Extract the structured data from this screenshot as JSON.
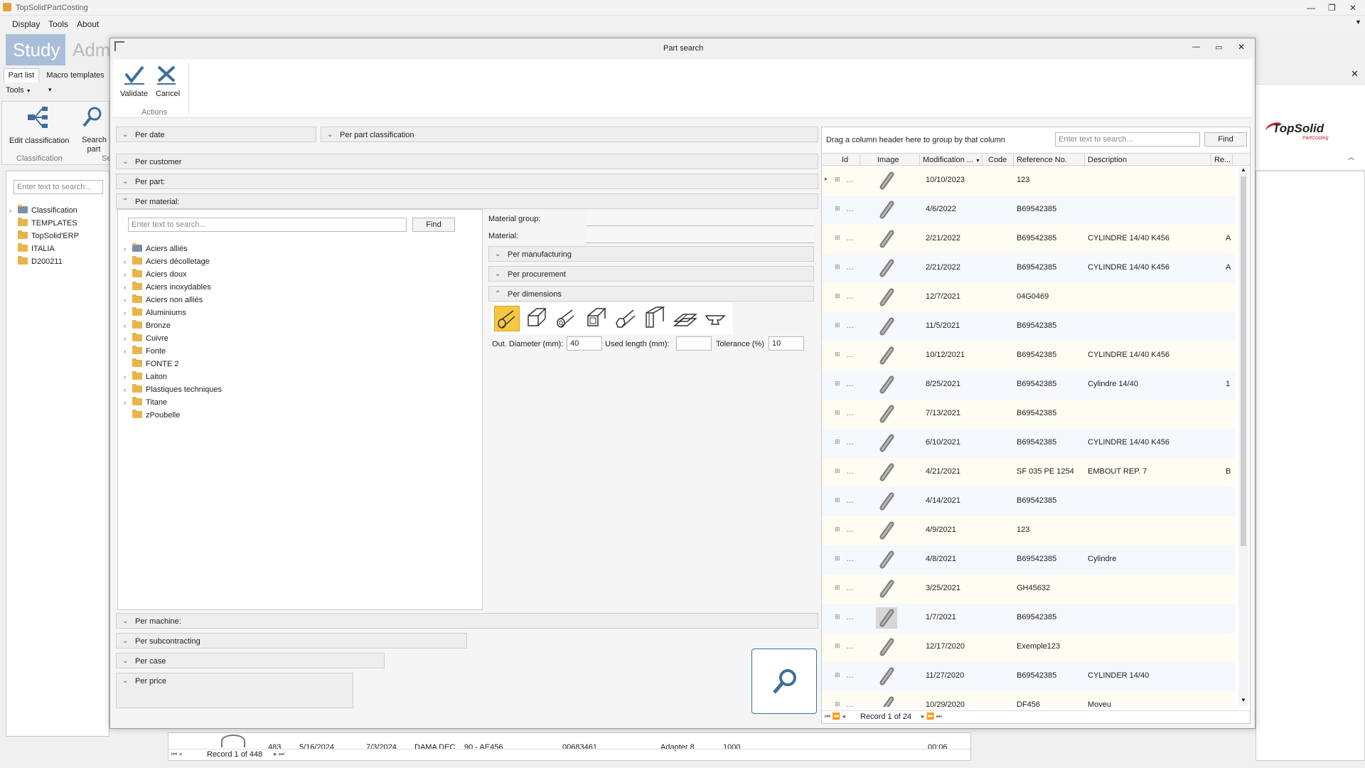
{
  "app": {
    "title": "TopSolid'PartCosting",
    "menu": [
      "Display",
      "Tools",
      "About"
    ]
  },
  "left": {
    "big_tabs": [
      "Study",
      "Adm"
    ],
    "tabs": [
      "Part list",
      "Macro templates"
    ],
    "tools_label": "Tools",
    "ribbon": {
      "edit_label": "Edit classification",
      "search_label": "Search part",
      "group1": "Classification",
      "group2": "Se"
    },
    "search_placeholder": "Enter text to search...",
    "tree": [
      "Classification",
      "TEMPLATES",
      "TopSolid'ERP",
      "ITALIA",
      "D200211"
    ]
  },
  "bottom": {
    "cells": [
      "483",
      "5/16/2024",
      "7/3/2024",
      "DAMA DEC",
      "90 - AE456",
      "00683461",
      "Adapter 8",
      "1000",
      "00:06"
    ],
    "record": "Record 1 of 448"
  },
  "dialog": {
    "title": "Part search",
    "validate": "Validate",
    "cancel": "Cancel",
    "actions": "Actions",
    "sections": {
      "per_date": "Per date",
      "per_part_class": "Per part classification",
      "per_customer": "Per customer",
      "per_part": "Per part:",
      "per_material": "Per material:",
      "per_machine": "Per machine:",
      "per_subcontracting": "Per subcontracting",
      "per_case": "Per case",
      "per_price": "Per price",
      "per_manufacturing": "Per manufacturing",
      "per_procurement": "Per procurement",
      "per_dimensions": "Per dimensions"
    },
    "material_search_placeholder": "Enter text to search...",
    "find": "Find",
    "materials": [
      "Aciers alliés",
      "Aciers décolletage",
      "Aciers doux",
      "Aciers inoxydables",
      "Aciers non alliés",
      "Aluminiums",
      "Bronze",
      "Cuivre",
      "Fonte",
      "FONTE 2",
      "Laiton",
      "Plastiques techniques",
      "Titane",
      "zPoubelle"
    ],
    "material_group_label": "Material group:",
    "material_label": "Material:",
    "dims": {
      "out_diameter_label": "Out. Diameter (mm):",
      "out_diameter_value": "40",
      "used_length_label": "Used length (mm):",
      "used_length_value": "",
      "tolerance_label": "Tolerance (%)",
      "tolerance_value": "10"
    },
    "grid": {
      "group_hint": "Drag a column header here to group by that column",
      "search_placeholder": "Enter text to search...",
      "find": "Find",
      "headers": [
        "Id",
        "Image",
        "Modification ...",
        "Code",
        "Reference No.",
        "Description",
        "Re..."
      ],
      "rows": [
        {
          "date": "10/10/2023",
          "ref": "123",
          "desc": "",
          "re": ""
        },
        {
          "date": "4/6/2022",
          "ref": "B69542385",
          "desc": "",
          "re": ""
        },
        {
          "date": "2/21/2022",
          "ref": "B69542385",
          "desc": "CYLINDRE 14/40 K456",
          "re": "A"
        },
        {
          "date": "2/21/2022",
          "ref": "B69542385",
          "desc": "CYLINDRE 14/40 K456",
          "re": "A"
        },
        {
          "date": "12/7/2021",
          "ref": "04G0469",
          "desc": "",
          "re": ""
        },
        {
          "date": "11/5/2021",
          "ref": "B69542385",
          "desc": "",
          "re": ""
        },
        {
          "date": "10/12/2021",
          "ref": "B69542385",
          "desc": "CYLINDRE 14/40 K456",
          "re": ""
        },
        {
          "date": "8/25/2021",
          "ref": "B69542385",
          "desc": "Cylindre 14/40",
          "re": "1"
        },
        {
          "date": "7/13/2021",
          "ref": "B69542385",
          "desc": "",
          "re": ""
        },
        {
          "date": "6/10/2021",
          "ref": "B69542385",
          "desc": "CYLINDRE 14/40 K456",
          "re": ""
        },
        {
          "date": "4/21/2021",
          "ref": "SF 035 PE 1254",
          "desc": "EMBOUT REP. 7",
          "re": "B"
        },
        {
          "date": "4/14/2021",
          "ref": "B69542385",
          "desc": "",
          "re": ""
        },
        {
          "date": "4/9/2021",
          "ref": "123",
          "desc": "",
          "re": ""
        },
        {
          "date": "4/8/2021",
          "ref": "B69542385",
          "desc": "Cylindre",
          "re": ""
        },
        {
          "date": "3/25/2021",
          "ref": "GH45632",
          "desc": "",
          "re": ""
        },
        {
          "date": "1/7/2021",
          "ref": "B69542385",
          "desc": "",
          "re": ""
        },
        {
          "date": "12/17/2020",
          "ref": "Exemple123",
          "desc": "",
          "re": ""
        },
        {
          "date": "11/27/2020",
          "ref": "B69542385",
          "desc": "CYLINDER 14/40",
          "re": ""
        },
        {
          "date": "10/29/2020",
          "ref": "DF456",
          "desc": "Moyeu",
          "re": ""
        }
      ],
      "record": "Record 1 of 24"
    }
  },
  "logo": {
    "name": "TopSolid",
    "sub": "PartCosting"
  }
}
